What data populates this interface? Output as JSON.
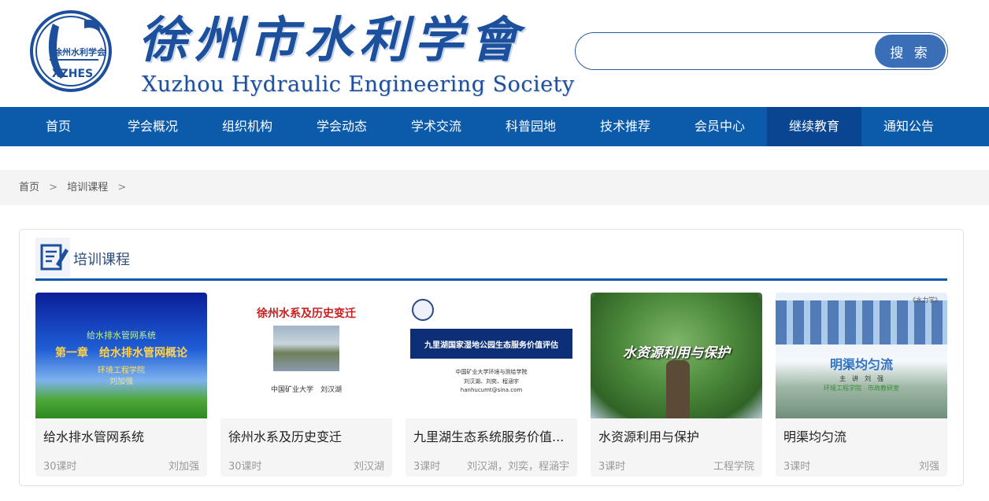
{
  "header": {
    "logo_text_top": "徐州水利学会",
    "logo_text_bottom": "XZHES",
    "title_cn": "徐州市水利学會",
    "title_en": "Xuzhou Hydraulic Engineering Society",
    "search_placeholder": "",
    "search_button": "搜 索"
  },
  "nav": {
    "items": [
      {
        "label": "首页"
      },
      {
        "label": "学会概况"
      },
      {
        "label": "组织机构"
      },
      {
        "label": "学会动态"
      },
      {
        "label": "学术交流"
      },
      {
        "label": "科普园地"
      },
      {
        "label": "技术推荐"
      },
      {
        "label": "会员中心"
      },
      {
        "label": "继续教育",
        "active": true
      },
      {
        "label": "通知公告"
      }
    ]
  },
  "breadcrumb": {
    "home": "首页",
    "current": "培训课程",
    "separator": ">"
  },
  "panel": {
    "title": "培训课程",
    "courses": [
      {
        "title": "给水排水管网系统",
        "hours": "30课时",
        "author": "刘加强",
        "thumb": {
          "line1": "给水排水管网系统",
          "line2": "第一章　给水排水管网概论",
          "line3": "环境工程学院",
          "line4": "刘加强"
        }
      },
      {
        "title": "徐州水系及历史变迁",
        "hours": "30课时",
        "author": "刘汉湖",
        "thumb": {
          "line1": "徐州水系及历史变迁",
          "line2": "中国矿业大学　刘汉湖"
        }
      },
      {
        "title": "九里湖生态系统服务价值...",
        "hours": "3课时",
        "author": "刘汉湖，刘奕，程涵宇",
        "thumb": {
          "line1": "九里湖国家湿地公园生态服务价值评估",
          "line2": "中国矿业大学环境与测绘学院",
          "line3": "刘汉湖、刘奕、程涵宇",
          "line4": "hanhucumt@sina.com"
        }
      },
      {
        "title": "水资源利用与保护",
        "hours": "3课时",
        "author": "工程学院",
        "thumb": {
          "line1": "水资源利用与保护"
        }
      },
      {
        "title": "明渠均匀流",
        "hours": "3课时",
        "author": "刘强",
        "thumb": {
          "tag": "《水力学》",
          "line1": "明渠均匀流",
          "line2": "主　讲　刘　强",
          "line3": "环境工程学院　市政教研室"
        }
      }
    ]
  }
}
